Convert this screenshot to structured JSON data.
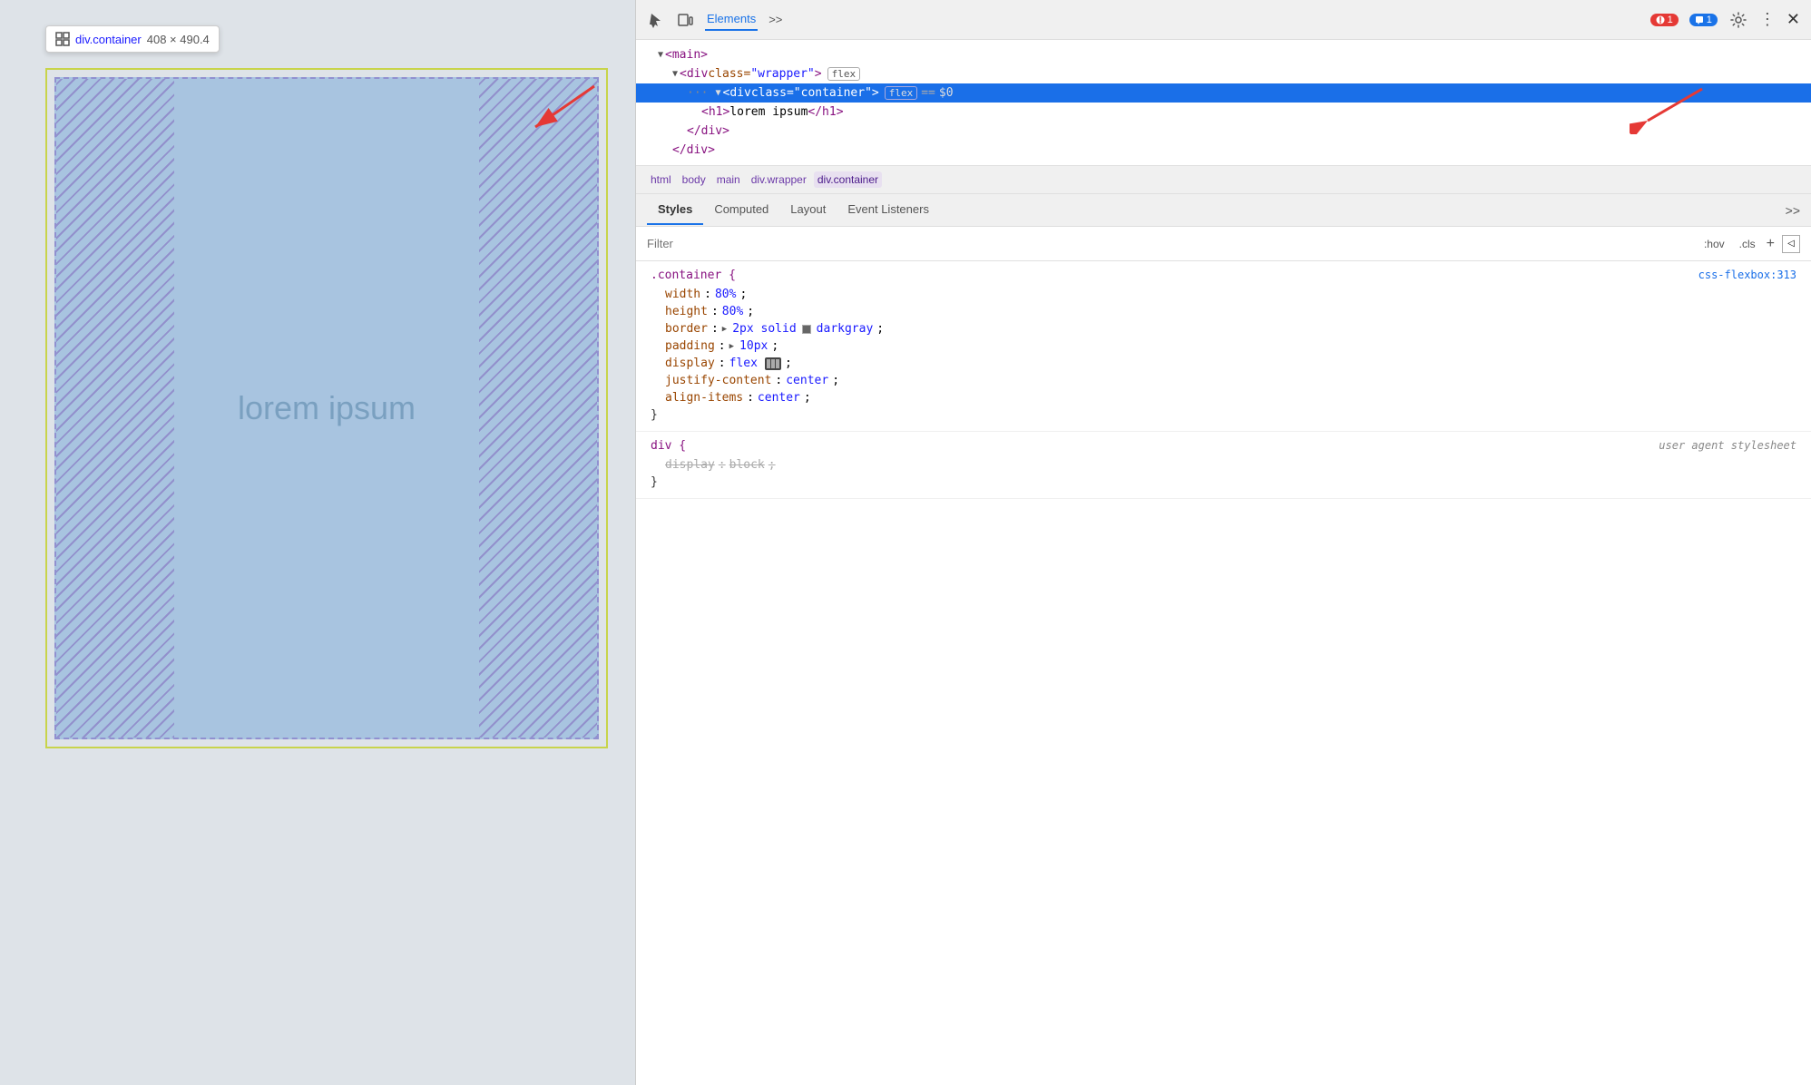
{
  "tooltip": {
    "element": "div.container",
    "size": "408 × 490.4"
  },
  "devtools": {
    "tabs": [
      "Elements",
      ">>"
    ],
    "active_tab": "Elements",
    "error_count": "1",
    "chat_count": "1"
  },
  "dom": {
    "lines": [
      {
        "id": "main",
        "indent": 1,
        "content": "<main>",
        "selected": false
      },
      {
        "id": "wrapper",
        "indent": 2,
        "content": "<div class=\"wrapper\">",
        "badge": "flex",
        "selected": false
      },
      {
        "id": "container",
        "indent": 3,
        "content": "<div class=\"container\">",
        "badge": "flex",
        "extra": "== $0",
        "selected": true
      },
      {
        "id": "h1",
        "indent": 4,
        "content": "<h1>lorem ipsum</h1>",
        "selected": false
      },
      {
        "id": "close-div1",
        "indent": 3,
        "content": "</div>",
        "selected": false
      },
      {
        "id": "close-div2",
        "indent": 2,
        "content": "</div>",
        "selected": false
      }
    ]
  },
  "breadcrumb": {
    "items": [
      "html",
      "body",
      "main",
      "div.wrapper",
      "div.container"
    ]
  },
  "panel_tabs": {
    "tabs": [
      "Styles",
      "Computed",
      "Layout",
      "Event Listeners",
      ">>"
    ],
    "active": "Styles"
  },
  "filter": {
    "placeholder": "Filter",
    "hov_label": ":hov",
    "cls_label": ".cls"
  },
  "css_rules": [
    {
      "selector": ".container {",
      "source": "css-flexbox:313",
      "properties": [
        {
          "prop": "width",
          "val": "80%",
          "strikethrough": false
        },
        {
          "prop": "height",
          "val": "80%",
          "strikethrough": false
        },
        {
          "prop": "border",
          "val": "2px solid",
          "color": "#666666",
          "color_name": "darkgray",
          "strikethrough": false
        },
        {
          "prop": "padding",
          "val": "10px",
          "triangle": true,
          "strikethrough": false
        },
        {
          "prop": "display",
          "val": "flex",
          "icon": true,
          "strikethrough": false
        },
        {
          "prop": "justify-content",
          "val": "center",
          "strikethrough": false
        },
        {
          "prop": "align-items",
          "val": "center",
          "strikethrough": false
        }
      ]
    },
    {
      "selector": "div {",
      "source": "user agent stylesheet",
      "properties": [
        {
          "prop": "display",
          "val": "block",
          "strikethrough": true
        }
      ]
    }
  ],
  "lorem_text": "lorem ipsum",
  "preview_bg": "#dee3e8"
}
